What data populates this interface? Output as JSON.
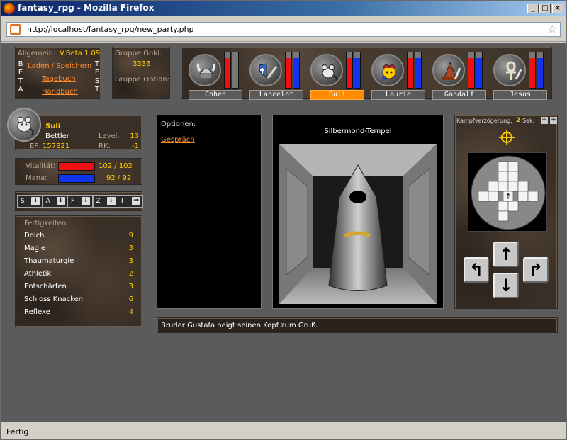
{
  "browser": {
    "title": "fantasy_rpg - Mozilla Firefox",
    "url": "http://localhost/fantasy_rpg/new_party.php",
    "status": "Fertig"
  },
  "general": {
    "label": "Allgemein:",
    "version": "V.Beta 1.09",
    "beta_letters": [
      "B",
      "E",
      "T",
      "A"
    ],
    "test_letters": [
      "T",
      "E",
      "S",
      "T"
    ],
    "links": [
      "Laden / Speichern",
      "Tagebuch",
      "Handbuch"
    ]
  },
  "group": {
    "gold_label": "Gruppe Gold:",
    "gold": "3336",
    "option_label": "Gruppe Option:"
  },
  "heroes": [
    {
      "name": "Cohen",
      "icon": "viking-helmet-icon",
      "hp": 0.85,
      "mana": 0.0,
      "selected": false
    },
    {
      "name": "Lancelot",
      "icon": "shield-sword-icon",
      "hp": 0.85,
      "mana": 0.85,
      "selected": false
    },
    {
      "name": "Suli",
      "icon": "rat-icon",
      "hp": 0.85,
      "mana": 0.85,
      "selected": true
    },
    {
      "name": "Laurie",
      "icon": "jester-icon",
      "hp": 0.85,
      "mana": 0.85,
      "selected": false
    },
    {
      "name": "Gandalf",
      "icon": "wizard-hat-icon",
      "hp": 0.85,
      "mana": 0.85,
      "selected": false
    },
    {
      "name": "Jesus",
      "icon": "ankh-icon",
      "hp": 0.85,
      "mana": 0.85,
      "selected": false
    }
  ],
  "char": {
    "name": "Suli",
    "class": "Bettler",
    "level_label": "Level:",
    "level": "13",
    "ep_label": "EP:",
    "ep": "157821",
    "rk_label": "RK:",
    "rk": "-1",
    "vit_label": "Vitalität:",
    "vit": "102 / 102",
    "vit_frac": 1.0,
    "mana_label": "Mana:",
    "mana": "92 / 92",
    "mana_frac": 1.0
  },
  "slots": [
    {
      "label": "S",
      "icon": "arrow-down-icon"
    },
    {
      "label": "A",
      "icon": "arrow-down-icon"
    },
    {
      "label": "F",
      "icon": "arrow-down-icon"
    },
    {
      "label": "Z",
      "icon": "arrow-down-icon"
    },
    {
      "label": "I",
      "icon": "arrow-right-icon"
    }
  ],
  "skills": {
    "label": "Fertigkeiten:",
    "items": [
      {
        "name": "Dolch",
        "value": "9"
      },
      {
        "name": "Magie",
        "value": "3"
      },
      {
        "name": "Thaumaturgie",
        "value": "3"
      },
      {
        "name": "Athletik",
        "value": "2"
      },
      {
        "name": "Entschärfen",
        "value": "3"
      },
      {
        "name": "Schloss Knacken",
        "value": "6"
      },
      {
        "name": "Reflexe",
        "value": "4"
      }
    ]
  },
  "options": {
    "label": "Optionen:",
    "talk": "Gespräch"
  },
  "view": {
    "location": "Silbermond-Tempel"
  },
  "combat": {
    "delay_label": "Kampfverzögerung:",
    "delay_value": "2",
    "delay_unit": "Sek.",
    "minus": "−",
    "plus": "+"
  },
  "message": "Bruder Gustafa neigt seinen Kopf zum Gruß.",
  "colors": {
    "hp": "#ee1111",
    "mana": "#1133ee",
    "accent": "#ff8c00"
  }
}
